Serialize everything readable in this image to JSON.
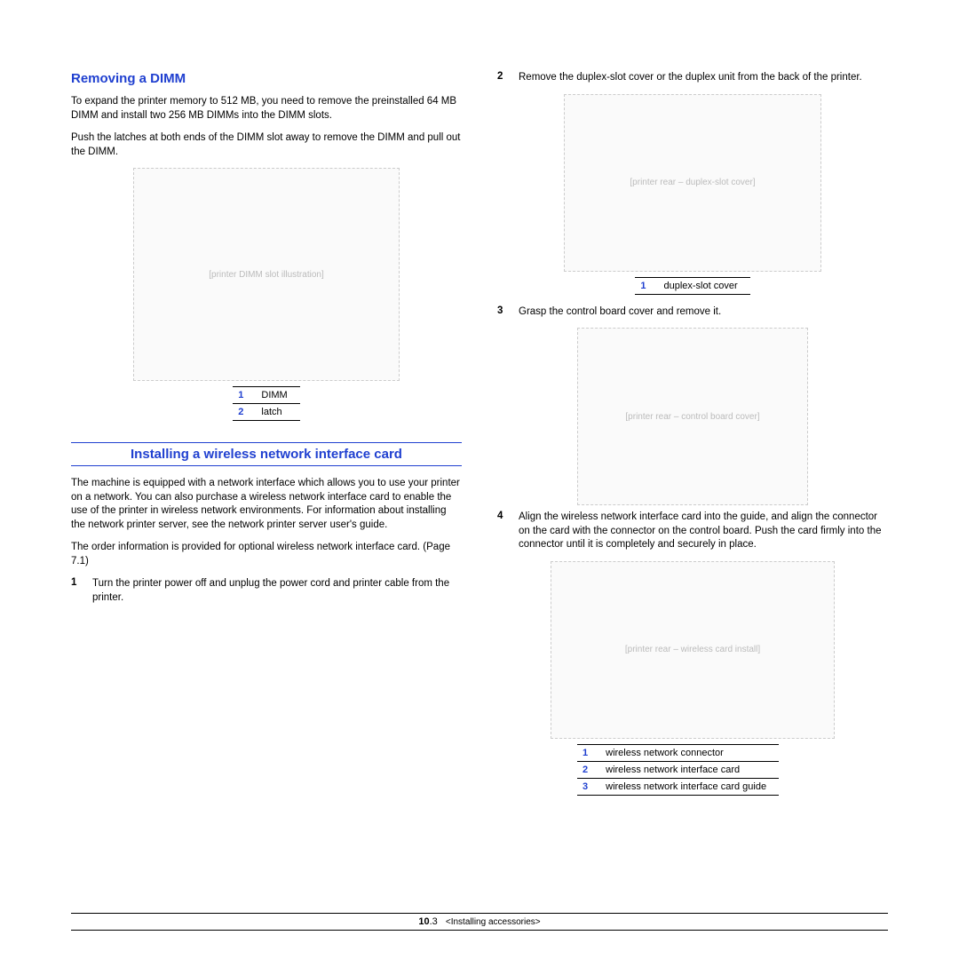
{
  "left": {
    "h_remove": "Removing a DIMM",
    "p1": "To expand the printer memory to 512 MB, you need to remove the preinstalled 64 MB DIMM and install two 256 MB DIMMs into the DIMM slots.",
    "p2": "Push the latches at both ends of the DIMM slot away to remove the DIMM and pull out the DIMM.",
    "callout1": [
      {
        "n": "1",
        "label": "DIMM"
      },
      {
        "n": "2",
        "label": "latch"
      }
    ],
    "h_install": "Installing a wireless network interface card",
    "p3": "The machine is equipped with a network interface which allows you to use your printer on a network. You can also purchase a wireless network interface card to enable the use of the printer in wireless network environments. For information about installing the network printer server, see the network printer server user's guide.",
    "p4": "The order information is provided for optional wireless network interface card. (Page 7.1)",
    "step1": {
      "n": "1",
      "txt": "Turn the printer power off and unplug the power cord and printer cable from the printer."
    }
  },
  "right": {
    "step2": {
      "n": "2",
      "txt": "Remove the duplex-slot cover or the duplex unit from the back of the printer."
    },
    "callout2": [
      {
        "n": "1",
        "label": "duplex-slot cover"
      }
    ],
    "step3": {
      "n": "3",
      "txt": "Grasp the control board cover and remove it."
    },
    "step4": {
      "n": "4",
      "txt": "Align the wireless network interface card into the guide, and align the connector on the card with the connector on the control board. Push the card firmly into the connector until it is completely and securely in place."
    },
    "callout4": [
      {
        "n": "1",
        "label": "wireless network connector"
      },
      {
        "n": "2",
        "label": "wireless network interface card"
      },
      {
        "n": "3",
        "label": "wireless network interface card guide"
      }
    ]
  },
  "footer": {
    "page_major": "10",
    "page_minor": ".3",
    "crumb": "<Installing accessories>"
  },
  "fig_labels": {
    "f1": "[printer DIMM slot illustration]",
    "f2": "[printer rear – duplex-slot cover]",
    "f3": "[printer rear – control board cover]",
    "f4": "[printer rear – wireless card install]"
  }
}
